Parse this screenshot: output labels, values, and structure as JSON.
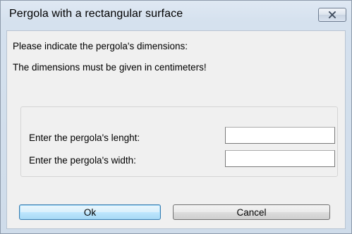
{
  "window": {
    "title": "Pergola with a rectangular surface"
  },
  "instructions": {
    "line1": "Please indicate the pergola's dimensions:",
    "line2": "The dimensions must be given in centimeters!"
  },
  "form": {
    "length_label": "Enter the pergola's lenght:",
    "length_value": "",
    "width_label": "Enter the pergola's width:",
    "width_value": ""
  },
  "buttons": {
    "ok_label": "Ok",
    "cancel_label": "Cancel"
  },
  "icons": {
    "close": "close-icon"
  },
  "colors": {
    "frame": "#d5e1ee",
    "client": "#f0f0f0",
    "default_button": "#bee6fd"
  }
}
